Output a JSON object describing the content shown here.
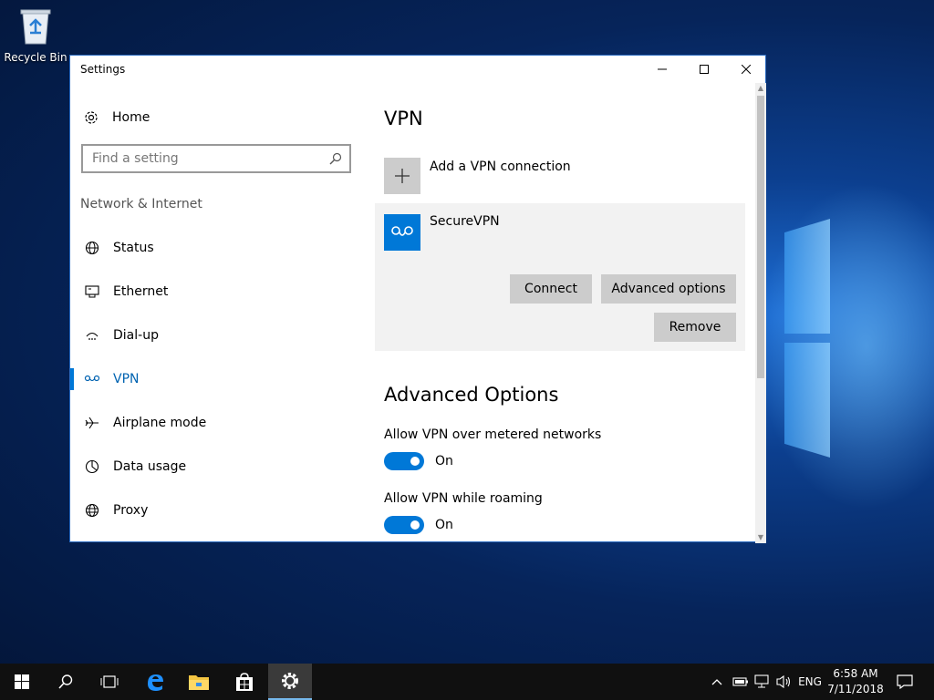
{
  "desktop": {
    "recycle_bin_label": "Recycle Bin"
  },
  "window": {
    "title": "Settings",
    "controls": {
      "minimize": "minimize",
      "maximize": "maximize",
      "close": "close"
    }
  },
  "sidebar": {
    "home_label": "Home",
    "search_placeholder": "Find a setting",
    "section_title": "Network & Internet",
    "items": [
      {
        "label": "Status",
        "icon": "globe-icon"
      },
      {
        "label": "Ethernet",
        "icon": "ethernet-icon"
      },
      {
        "label": "Dial-up",
        "icon": "dialup-icon"
      },
      {
        "label": "VPN",
        "icon": "vpn-icon",
        "active": true
      },
      {
        "label": "Airplane mode",
        "icon": "airplane-icon"
      },
      {
        "label": "Data usage",
        "icon": "data-usage-icon"
      },
      {
        "label": "Proxy",
        "icon": "proxy-icon"
      }
    ]
  },
  "main": {
    "title": "VPN",
    "add_connection_label": "Add a VPN connection",
    "connection": {
      "name": "SecureVPN",
      "connect_label": "Connect",
      "advanced_label": "Advanced options",
      "remove_label": "Remove"
    },
    "advanced_title": "Advanced Options",
    "options": [
      {
        "label": "Allow VPN over metered networks",
        "state": "On"
      },
      {
        "label": "Allow VPN while roaming",
        "state": "On"
      }
    ]
  },
  "taskbar": {
    "language": "ENG",
    "time": "6:58 AM",
    "date": "7/11/2018"
  },
  "colors": {
    "accent": "#0078d7",
    "button": "#cccccc",
    "card": "#f2f2f2",
    "taskbar": "#101010"
  }
}
